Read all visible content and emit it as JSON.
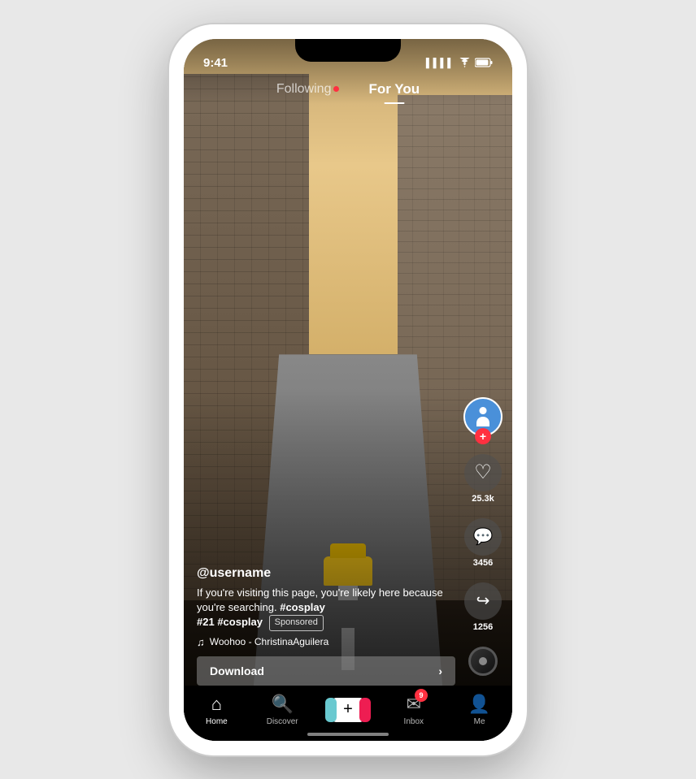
{
  "phone": {
    "status_bar": {
      "time": "9:41",
      "signal_bars": "▌▌▌",
      "wifi": "WiFi",
      "battery": "Battery"
    },
    "top_nav": {
      "following_label": "Following",
      "for_you_label": "For You",
      "active_tab": "for_you",
      "live_indicator": true
    },
    "video": {
      "username": "@username",
      "description_text": "If you're visiting this page, you're likely here because you're searching.",
      "hashtag1": "#cosplay",
      "hashtag2": "#21",
      "hashtag3": "#cosplay",
      "sponsored_label": "Sponsored",
      "music_note": "♫",
      "music_info": "Woohoo - ChristinaAguilera",
      "download_label": "Download",
      "download_arrow": "›"
    },
    "right_sidebar": {
      "follow_plus": "+",
      "likes_count": "25.3k",
      "comments_count": "3456",
      "shares_count": "1256"
    },
    "bottom_nav": {
      "home_label": "Home",
      "discover_label": "Discover",
      "plus_label": "",
      "inbox_label": "Inbox",
      "inbox_badge": "9",
      "me_label": "Me"
    }
  }
}
